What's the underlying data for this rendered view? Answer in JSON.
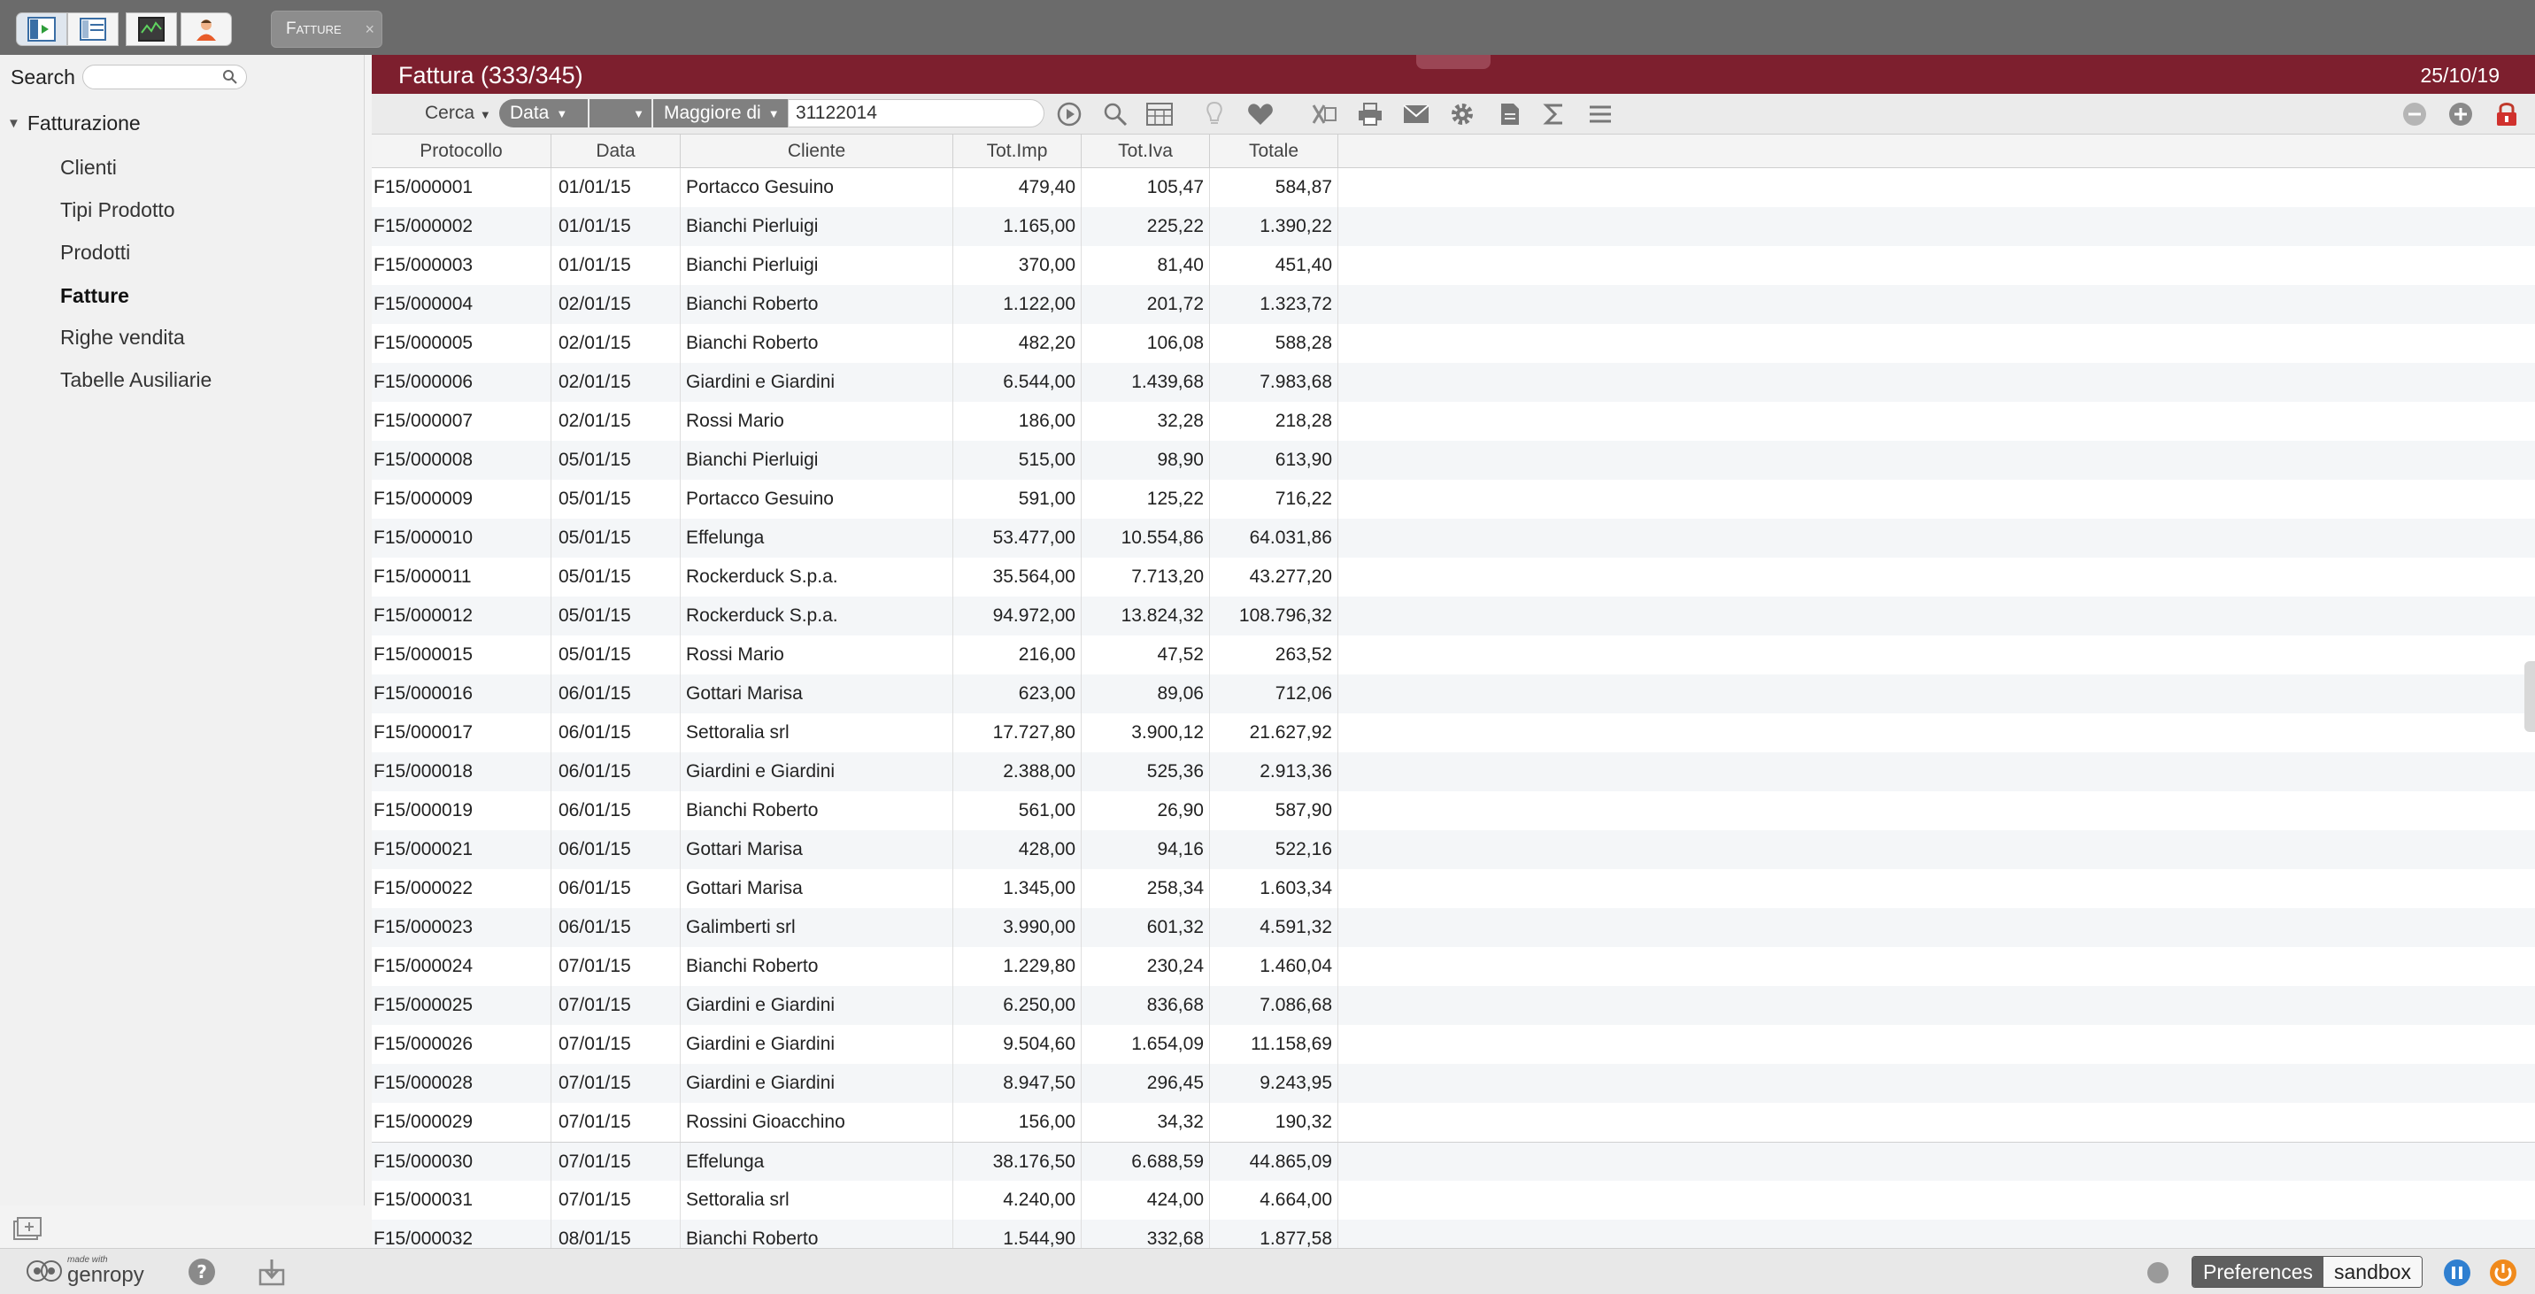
{
  "topbar": {
    "tab_label": "Fatture",
    "tab_close": "×",
    "buttons": [
      {
        "name": "frame-toggle-icon"
      },
      {
        "name": "layout-icon"
      },
      {
        "name": "monitor-icon"
      },
      {
        "name": "user-icon"
      }
    ]
  },
  "sidebar": {
    "search_label": "Search",
    "search_value": "",
    "root_label": "Fatturazione",
    "items": [
      {
        "label": "Clienti",
        "selected": false
      },
      {
        "label": "Tipi Prodotto",
        "selected": false
      },
      {
        "label": "Prodotti",
        "selected": false
      },
      {
        "label": "Fatture",
        "selected": true
      },
      {
        "label": "Righe vendita",
        "selected": false
      },
      {
        "label": "Tabelle Ausiliarie",
        "selected": false
      }
    ]
  },
  "header": {
    "title": "Fattura (333/345)",
    "date": "25/10/19"
  },
  "toolbar": {
    "cerca_label": "Cerca",
    "field_label": "Data",
    "op_label": "",
    "condition_label": "Maggiore di",
    "value": "31122014"
  },
  "grid": {
    "columns": [
      "Protocollo",
      "Data",
      "Cliente",
      "Tot.Imp",
      "Tot.Iva",
      "Totale"
    ],
    "rows": [
      [
        "F15/000001",
        "01/01/15",
        "Portacco Gesuino",
        "479,40",
        "105,47",
        "584,87"
      ],
      [
        "F15/000002",
        "01/01/15",
        "Bianchi Pierluigi",
        "1.165,00",
        "225,22",
        "1.390,22"
      ],
      [
        "F15/000003",
        "01/01/15",
        "Bianchi Pierluigi",
        "370,00",
        "81,40",
        "451,40"
      ],
      [
        "F15/000004",
        "02/01/15",
        "Bianchi Roberto",
        "1.122,00",
        "201,72",
        "1.323,72"
      ],
      [
        "F15/000005",
        "02/01/15",
        "Bianchi Roberto",
        "482,20",
        "106,08",
        "588,28"
      ],
      [
        "F15/000006",
        "02/01/15",
        "Giardini e Giardini",
        "6.544,00",
        "1.439,68",
        "7.983,68"
      ],
      [
        "F15/000007",
        "02/01/15",
        "Rossi Mario",
        "186,00",
        "32,28",
        "218,28"
      ],
      [
        "F15/000008",
        "05/01/15",
        "Bianchi Pierluigi",
        "515,00",
        "98,90",
        "613,90"
      ],
      [
        "F15/000009",
        "05/01/15",
        "Portacco Gesuino",
        "591,00",
        "125,22",
        "716,22"
      ],
      [
        "F15/000010",
        "05/01/15",
        "Effelunga",
        "53.477,00",
        "10.554,86",
        "64.031,86"
      ],
      [
        "F15/000011",
        "05/01/15",
        "Rockerduck S.p.a.",
        "35.564,00",
        "7.713,20",
        "43.277,20"
      ],
      [
        "F15/000012",
        "05/01/15",
        "Rockerduck S.p.a.",
        "94.972,00",
        "13.824,32",
        "108.796,32"
      ],
      [
        "F15/000015",
        "05/01/15",
        "Rossi Mario",
        "216,00",
        "47,52",
        "263,52"
      ],
      [
        "F15/000016",
        "06/01/15",
        "Gottari Marisa",
        "623,00",
        "89,06",
        "712,06"
      ],
      [
        "F15/000017",
        "06/01/15",
        "Settoralia srl",
        "17.727,80",
        "3.900,12",
        "21.627,92"
      ],
      [
        "F15/000018",
        "06/01/15",
        "Giardini e Giardini",
        "2.388,00",
        "525,36",
        "2.913,36"
      ],
      [
        "F15/000019",
        "06/01/15",
        "Bianchi Roberto",
        "561,00",
        "26,90",
        "587,90"
      ],
      [
        "F15/000021",
        "06/01/15",
        "Gottari Marisa",
        "428,00",
        "94,16",
        "522,16"
      ],
      [
        "F15/000022",
        "06/01/15",
        "Gottari Marisa",
        "1.345,00",
        "258,34",
        "1.603,34"
      ],
      [
        "F15/000023",
        "06/01/15",
        "Galimberti srl",
        "3.990,00",
        "601,32",
        "4.591,32"
      ],
      [
        "F15/000024",
        "07/01/15",
        "Bianchi Roberto",
        "1.229,80",
        "230,24",
        "1.460,04"
      ],
      [
        "F15/000025",
        "07/01/15",
        "Giardini e Giardini",
        "6.250,00",
        "836,68",
        "7.086,68"
      ],
      [
        "F15/000026",
        "07/01/15",
        "Giardini e Giardini",
        "9.504,60",
        "1.654,09",
        "11.158,69"
      ],
      [
        "F15/000028",
        "07/01/15",
        "Giardini e Giardini",
        "8.947,50",
        "296,45",
        "9.243,95"
      ],
      [
        "F15/000029",
        "07/01/15",
        "Rossini Gioacchino",
        "156,00",
        "34,32",
        "190,32"
      ],
      [
        "F15/000030",
        "07/01/15",
        "Effelunga",
        "38.176,50",
        "6.688,59",
        "44.865,09"
      ],
      [
        "F15/000031",
        "07/01/15",
        "Settoralia srl",
        "4.240,00",
        "424,00",
        "4.664,00"
      ],
      [
        "F15/000032",
        "08/01/15",
        "Bianchi Roberto",
        "1.544,90",
        "332,68",
        "1.877,58"
      ]
    ]
  },
  "footer": {
    "logo_small": "made with",
    "logo_big": "genropy",
    "preferences_label": "Preferences",
    "sandbox_label": "sandbox"
  },
  "colors": {
    "accent": "#7d1f2e",
    "topbar": "#6b6b6b"
  }
}
